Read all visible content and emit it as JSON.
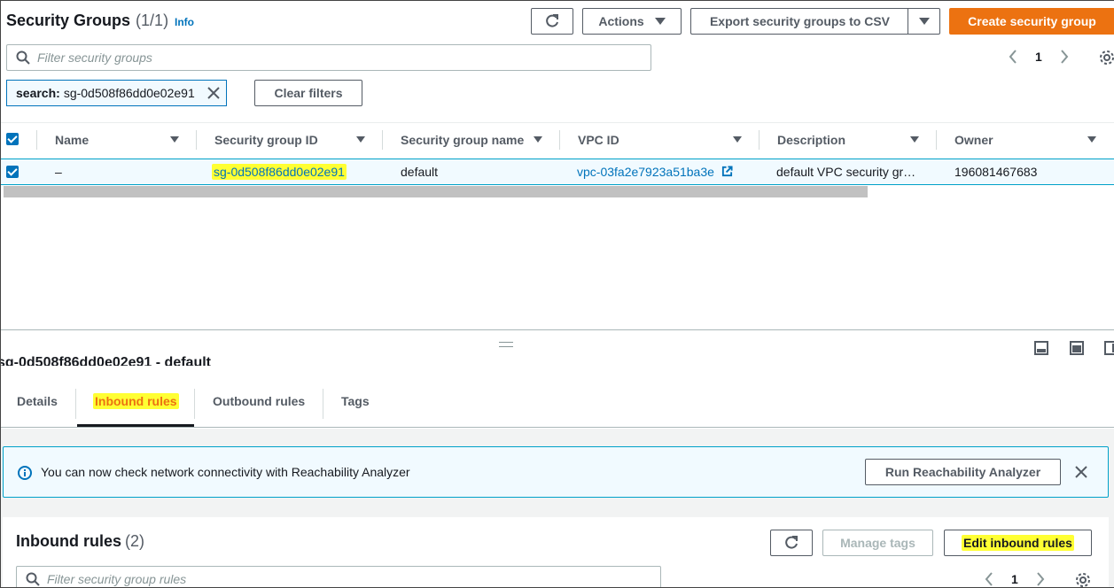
{
  "header": {
    "title": "Security Groups",
    "count": "(1/1)",
    "info": "Info",
    "actions_label": "Actions",
    "export_label": "Export security groups to CSV",
    "create_label": "Create security group"
  },
  "filter": {
    "placeholder": "Filter security groups",
    "token_key": "search:",
    "token_value": "sg-0d508f86dd0e02e91",
    "clear_label": "Clear filters"
  },
  "pagination": {
    "page": "1"
  },
  "table": {
    "columns": [
      "Name",
      "Security group ID",
      "Security group name",
      "VPC ID",
      "Description",
      "Owner"
    ],
    "rows": [
      {
        "name": "–",
        "sg_id": "sg-0d508f86dd0e02e91",
        "sg_name": "default",
        "vpc_id": "vpc-03fa2e7923a51ba3e",
        "description": "default VPC security gr…",
        "owner": "196081467683"
      }
    ]
  },
  "details": {
    "cut_title": "sg-0d508f86dd0e02e91 - default",
    "tabs": [
      "Details",
      "Inbound rules",
      "Outbound rules",
      "Tags"
    ],
    "active_tab": "Inbound rules"
  },
  "flash": {
    "message": "You can now check network connectivity with Reachability Analyzer",
    "button": "Run Reachability Analyzer"
  },
  "inbound": {
    "title": "Inbound rules",
    "count": "(2)",
    "manage_tags": "Manage tags",
    "edit_label": "Edit inbound rules",
    "filter_placeholder": "Filter security group rules",
    "page": "1"
  },
  "colors": {
    "primary": "#ec7211",
    "link": "#0073bb",
    "highlight": "#ffff33"
  }
}
